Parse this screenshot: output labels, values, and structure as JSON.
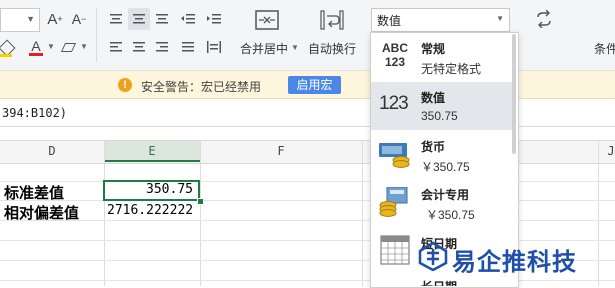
{
  "ribbon": {
    "font_size_value": "",
    "merge_center_label": "合并居中",
    "wrap_text_label": "自动换行",
    "conditional_label": "条件",
    "number_format_value": "数值"
  },
  "security": {
    "warning_text": "安全警告：宏已经禁用",
    "enable_button": "启用宏"
  },
  "formula_bar": {
    "text": "394:B102)"
  },
  "columns": [
    "D",
    "E",
    "F",
    "J"
  ],
  "rows": [
    {
      "label": "标准差值",
      "value": "350.75"
    },
    {
      "label": "相对偏差值",
      "value": "2716.222222"
    }
  ],
  "format_menu": {
    "items": [
      {
        "title": "常规",
        "subtitle": "无特定格式",
        "icon": "general-abc123-icon"
      },
      {
        "title": "数值",
        "subtitle": "350.75",
        "icon": "number-123-icon"
      },
      {
        "title": "货币",
        "subtitle": "￥350.75",
        "icon": "currency-coins-icon"
      },
      {
        "title": "会计专用",
        "subtitle": "￥350.75",
        "icon": "accounting-icon"
      },
      {
        "title": "短日期",
        "subtitle": "",
        "icon": "calendar-icon"
      },
      {
        "title": "长日期",
        "subtitle": "",
        "icon": "calendar-icon"
      }
    ]
  },
  "watermark": "易企推科技",
  "colors": {
    "selection_green": "#1e7c45",
    "enable_macro_blue": "#4b87e6",
    "warning_orange": "#f0a11b",
    "watermark_blue": "#1f4fa8"
  }
}
